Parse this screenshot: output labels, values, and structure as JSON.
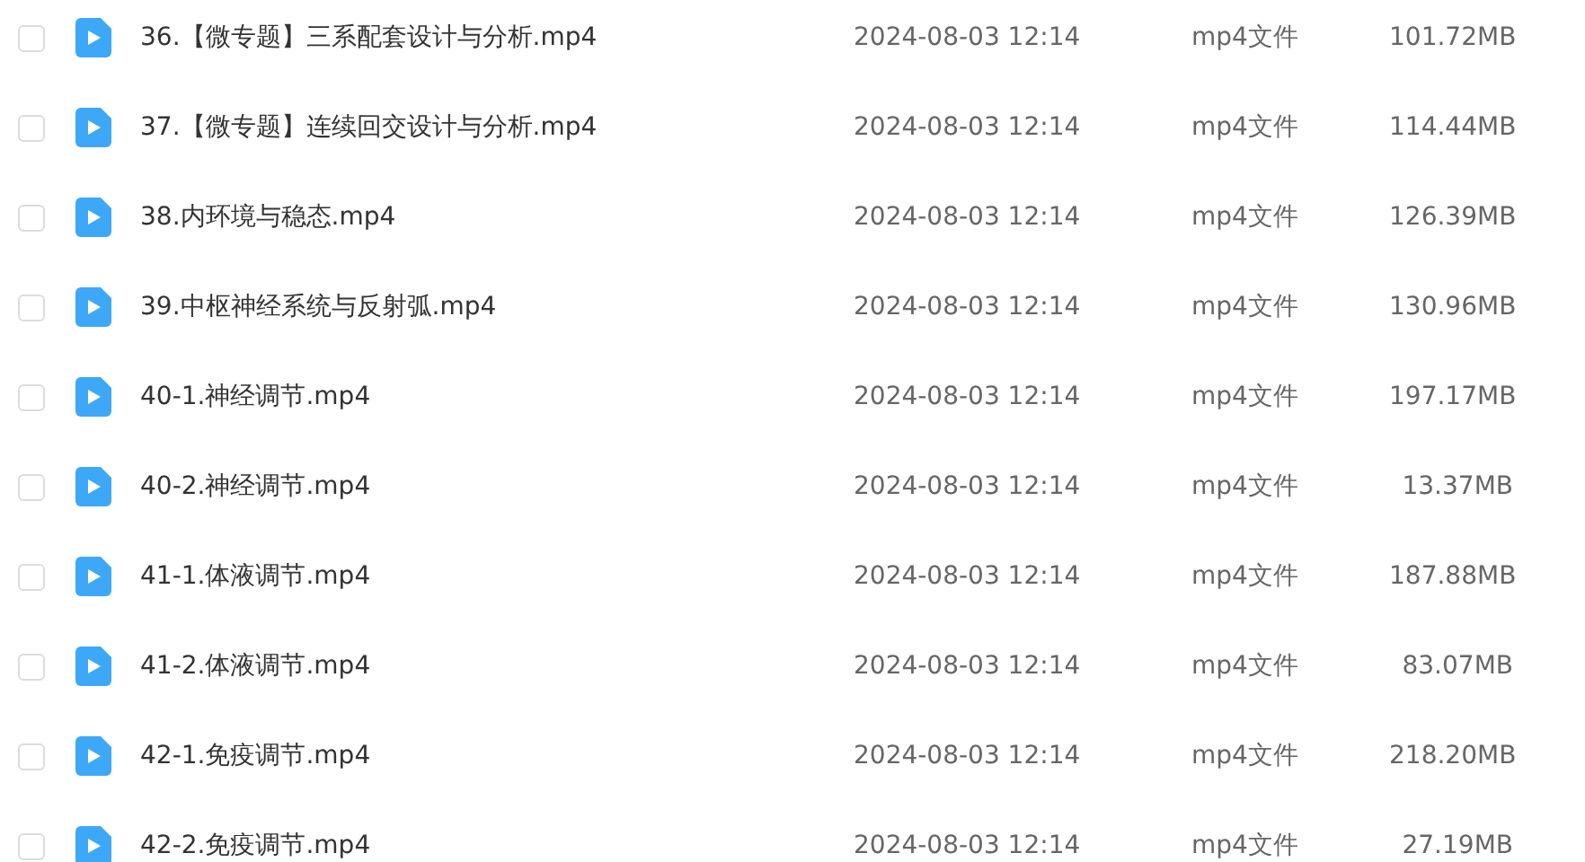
{
  "files": [
    {
      "name": "36.【微专题】三系配套设计与分析.mp4",
      "modified": "2024-08-03 12:14",
      "type": "mp4文件",
      "size": "101.72MB",
      "checked": false
    },
    {
      "name": "37.【微专题】连续回交设计与分析.mp4",
      "modified": "2024-08-03 12:14",
      "type": "mp4文件",
      "size": "114.44MB",
      "checked": false
    },
    {
      "name": "38.内环境与稳态.mp4",
      "modified": "2024-08-03 12:14",
      "type": "mp4文件",
      "size": "126.39MB",
      "checked": false
    },
    {
      "name": "39.中枢神经系统与反射弧.mp4",
      "modified": "2024-08-03 12:14",
      "type": "mp4文件",
      "size": "130.96MB",
      "checked": false
    },
    {
      "name": "40-1.神经调节.mp4",
      "modified": "2024-08-03 12:14",
      "type": "mp4文件",
      "size": "197.17MB",
      "checked": false
    },
    {
      "name": "40-2.神经调节.mp4",
      "modified": "2024-08-03 12:14",
      "type": "mp4文件",
      "size": "13.37MB",
      "checked": false
    },
    {
      "name": "41-1.体液调节.mp4",
      "modified": "2024-08-03 12:14",
      "type": "mp4文件",
      "size": "187.88MB",
      "checked": false
    },
    {
      "name": "41-2.体液调节.mp4",
      "modified": "2024-08-03 12:14",
      "type": "mp4文件",
      "size": "83.07MB",
      "checked": false
    },
    {
      "name": "42-1.免疫调节.mp4",
      "modified": "2024-08-03 12:14",
      "type": "mp4文件",
      "size": "218.20MB",
      "checked": false
    },
    {
      "name": "42-2.免疫调节.mp4",
      "modified": "2024-08-03 12:14",
      "type": "mp4文件",
      "size": "27.19MB",
      "checked": false
    }
  ]
}
